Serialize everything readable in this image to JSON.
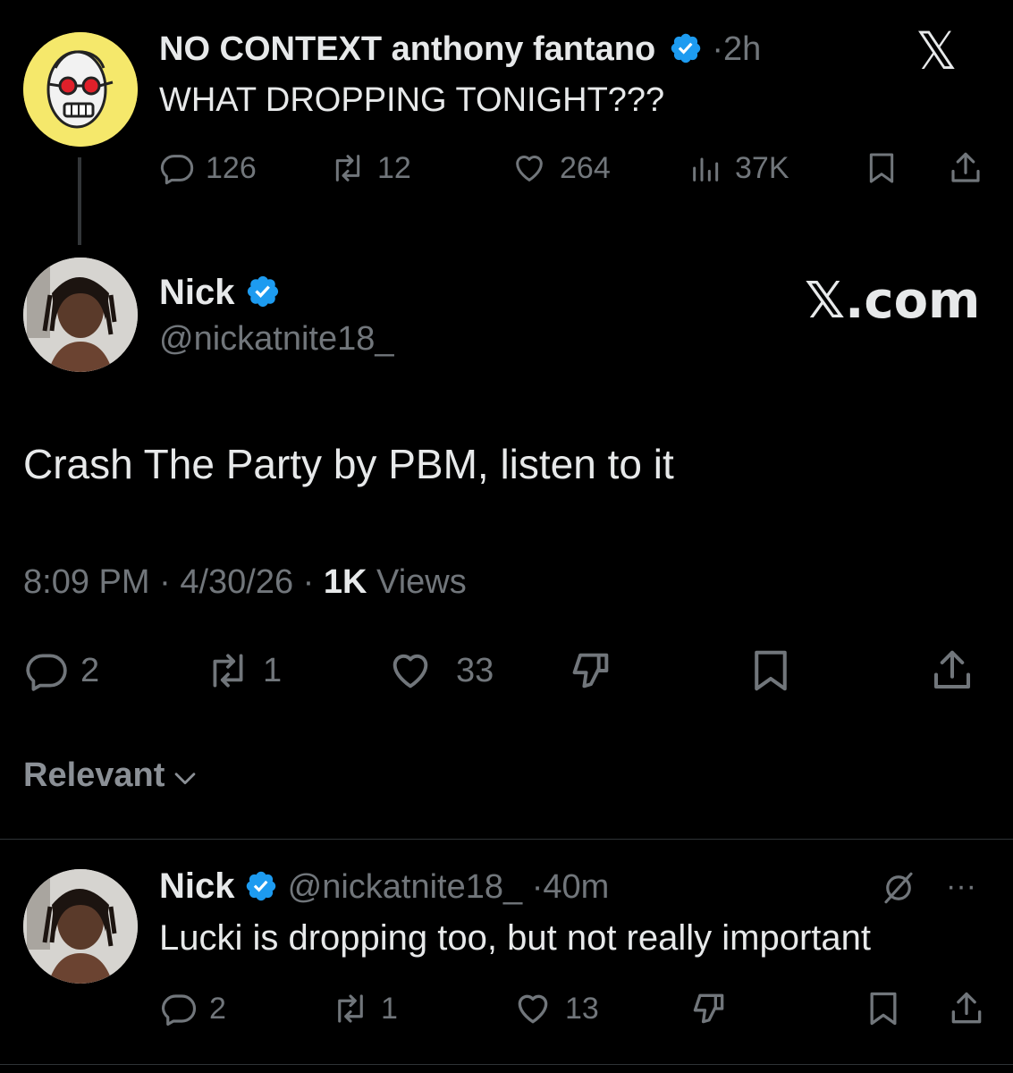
{
  "parent_tweet": {
    "display_name": "NO CONTEXT anthony fantano",
    "time": "2h",
    "separator": "·",
    "text": "WHAT DROPPING TONIGHT???",
    "avatar": "cartoon-face-red-glasses",
    "stats": {
      "replies": "126",
      "reposts": "12",
      "likes": "264",
      "views": "37K"
    }
  },
  "x_logo_glyph": "𝕏",
  "main_tweet": {
    "display_name": "Nick",
    "handle": "@nickatnite18_",
    "brand": "𝕏.com",
    "text": "Crash The Party by PBM, listen to it",
    "time": "8:09 PM",
    "date": "4/30/26",
    "views_count": "1K",
    "views_label": "Views",
    "separator": "·",
    "stats": {
      "replies": "2",
      "reposts": "1",
      "likes": "33"
    }
  },
  "sort": {
    "label": "Relevant"
  },
  "reply_tweet": {
    "display_name": "Nick",
    "handle": "@nickatnite18_",
    "time": "40m",
    "separator": "·",
    "text": "Lucki is dropping too, but not really important",
    "more": "···",
    "stats": {
      "replies": "2",
      "reposts": "1",
      "likes": "13"
    }
  },
  "colors": {
    "background": "#000000",
    "text": "#e7e9ea",
    "muted": "#71767b",
    "verified": "#1d9bf0",
    "divider": "#2f3336"
  }
}
